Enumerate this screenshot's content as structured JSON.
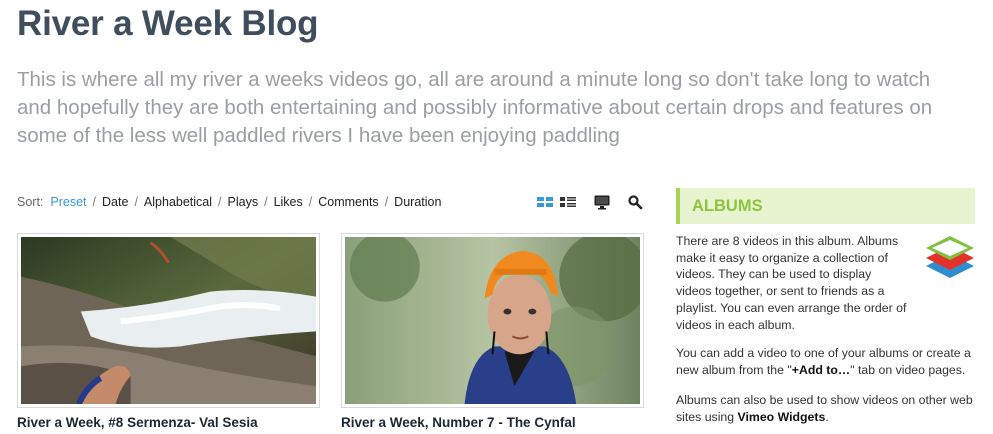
{
  "header": {
    "title": "River a Week Blog",
    "description": "This is where all my river a weeks videos go, all are around a minute long so don't take long to watch and hopefully they are both entertaining and possibly informative about certain drops and features on some of the less well paddled rivers I have been enjoying paddling"
  },
  "sort": {
    "label": "Sort:",
    "options": [
      "Preset",
      "Date",
      "Alphabetical",
      "Plays",
      "Likes",
      "Comments",
      "Duration"
    ],
    "separator": "/"
  },
  "videos": [
    {
      "title": "River a Week, #8 Sermenza- Val Sesia"
    },
    {
      "title": "River a Week, Number 7 - The Cynfal"
    }
  ],
  "albums": {
    "heading": "ALBUMS",
    "para1": "There are 8 videos in this album. Albums make it easy to organize a collection of videos. They can be used to display videos together, or sent to friends as a playlist. You can even arrange the order of videos in each album.",
    "para2_before": "You can add a video to one of your albums or create a new album from the \"",
    "para2_bold": "+Add to…",
    "para2_after": "\" tab on video pages.",
    "para3_before": "Albums can also be used to show videos on other web sites using ",
    "para3_bold": "Vimeo Widgets",
    "para3_after": "."
  },
  "colors": {
    "title": "#3f4e5c",
    "active_sort": "#3a9ad9",
    "albums_heading": "#8cc63e",
    "albums_bg": "#e8f3cf"
  },
  "icons": [
    "grid-view-icon",
    "list-view-icon",
    "monitor-icon",
    "search-icon",
    "albums-stack-icon"
  ]
}
